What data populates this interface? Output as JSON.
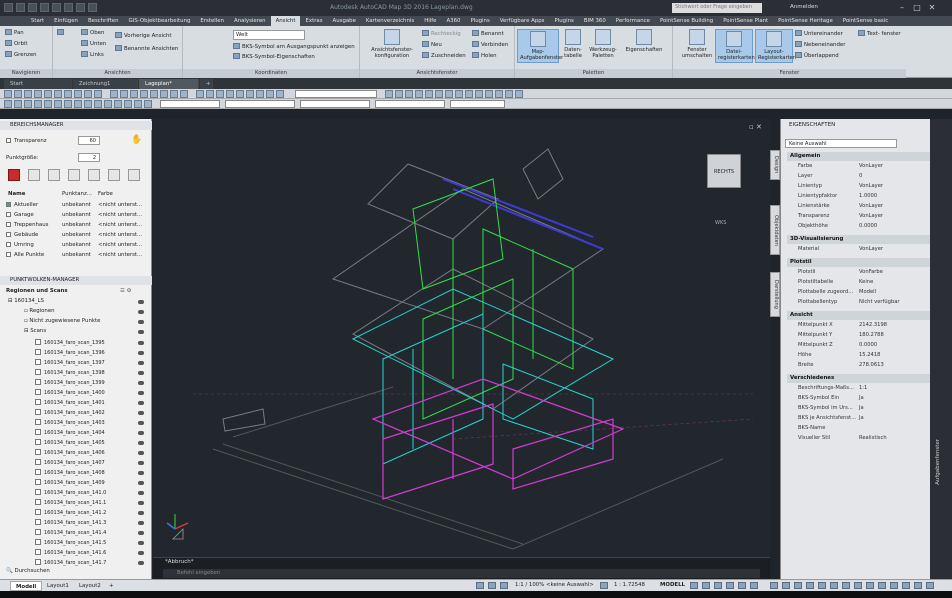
{
  "titlebar": {
    "title": "Autodesk AutoCAD Map 3D 2016   Lageplan.dwg",
    "search_placeholder": "Stichwort oder Frage eingeben",
    "login": "Anmelden"
  },
  "ribbon_tabs": [
    "Start",
    "Einfügen",
    "Beschriften",
    "GIS-Objektbearbeitung",
    "Erstellen",
    "Analysieren",
    "Ansicht",
    "Extras",
    "Ausgabe",
    "Kartenverzeichnis",
    "Hilfe",
    "A360",
    "Plugins",
    "Verfügbare Apps",
    "Plugins",
    "BIM 360",
    "Performance",
    "PointSense Building",
    "PointSense Plant",
    "PointSense Heritage",
    "PointSense basic"
  ],
  "ribbon": {
    "navigate": {
      "title": "Navigieren",
      "items": [
        "Pan",
        "Orbit",
        "Grenzen"
      ]
    },
    "views": {
      "title": "Ansichten",
      "items": [
        "Oben",
        "Unten",
        "Links"
      ],
      "prev_view": "Vorherige Ansicht",
      "named_views": "Benannte Ansichten"
    },
    "coords": {
      "title": "Koordinaten",
      "world": "Welt",
      "ucs_origin": "BKS-Symbol am Ausgangspunkt anzeigen",
      "ucs_props": "BKS-Symbol-Eigenschaften"
    },
    "viewports": {
      "title": "Ansichtsfenster",
      "config": "Ansichtsfenster-konfiguration",
      "rect": "Rechteckig",
      "new": "Neu",
      "clip": "Zuschneiden",
      "named": "Benannt",
      "join": "Verbinden",
      "restore": "Holen"
    },
    "palettes": {
      "title": "Paletten",
      "map_task": "Map-Aufgabenfenster",
      "data_table": "Daten-tabelle",
      "tool_palettes": "Werkzeug-Paletten",
      "properties": "Eigenschaften"
    },
    "window": {
      "title": "Fenster",
      "switch": "Fenster umschalten",
      "file_tabs": "Datei-registerkarten",
      "layout_tabs": "Layout-Registerkarten",
      "tile_h": "Untereinander",
      "tile_v": "Nebeneinander",
      "cascade": "Überlappend",
      "text_window": "Text- fenster"
    }
  },
  "doc_tabs": [
    "Start",
    "Zeichnung1",
    "Lageplan*"
  ],
  "left_panel": {
    "title": "BEREICHSMANAGER",
    "transparency_label": "Transparenz",
    "transparency_value": "60",
    "pointsize_label": "Punktgröße:",
    "pointsize_value": "2",
    "columns": [
      "Name",
      "Punktanz...",
      "Farbe"
    ],
    "regions": [
      {
        "name": "Aktueller",
        "count": "unbekannt",
        "color": "<nicht unterst..."
      },
      {
        "name": "Garage",
        "count": "unbekannt",
        "color": "<nicht unterst..."
      },
      {
        "name": "Treppenhaus",
        "count": "unbekannt",
        "color": "<nicht unterst..."
      },
      {
        "name": "Gebäude",
        "count": "unbekannt",
        "color": "<nicht unterst..."
      },
      {
        "name": "Umring",
        "count": "unbekannt",
        "color": "<nicht unterst..."
      },
      {
        "name": "Alle Punkte",
        "count": "unbekannt",
        "color": "<nicht unterst..."
      }
    ],
    "pcm_title": "PUNKTWOLKEN-MANAGER",
    "pcm_sub": "Regionen und Scans",
    "tree_root": "160134_LS",
    "tree_regions": "Regionen",
    "tree_unassigned": "Nicht zugewiesene Punkte",
    "tree_scans": "Scans",
    "scans": [
      "160134_faro_scan_1395",
      "160134_faro_scan_1396",
      "160134_faro_scan_1397",
      "160134_faro_scan_1398",
      "160134_faro_scan_1399",
      "160134_faro_scan_1400",
      "160134_faro_scan_1401",
      "160134_faro_scan_1402",
      "160134_faro_scan_1403",
      "160134_faro_scan_1404",
      "160134_faro_scan_1405",
      "160134_faro_scan_1406",
      "160134_faro_scan_1407",
      "160134_faro_scan_1408",
      "160134_faro_scan_1409",
      "160134_faro_scan_141.0",
      "160134_faro_scan_141.1",
      "160134_faro_scan_141.2",
      "160134_faro_scan_141.3",
      "160134_faro_scan_141.4",
      "160134_faro_scan_141.5",
      "160134_faro_scan_141.6",
      "160134_faro_scan_141.7"
    ],
    "search": "Durchsuchen"
  },
  "viewport": {
    "viewcube_label": "RECHTS",
    "viewcube_sub": "WKS"
  },
  "command": {
    "history": "*Abbruch*",
    "placeholder": "Befehl eingeben"
  },
  "properties": {
    "title": "EIGENSCHAFTEN",
    "selection": "Keine Auswahl",
    "sections": [
      {
        "title": "Allgemein",
        "rows": [
          [
            "Farbe",
            "VonLayer"
          ],
          [
            "Layer",
            "0"
          ],
          [
            "Linientyp",
            "VonLayer"
          ],
          [
            "Linientypfaktor",
            "1.0000"
          ],
          [
            "Linienstärke",
            "VonLayer"
          ],
          [
            "Transparenz",
            "VonLayer"
          ],
          [
            "Objekthöhe",
            "0.0000"
          ]
        ]
      },
      {
        "title": "3D-Visualisierung",
        "rows": [
          [
            "Material",
            "VonLayer"
          ]
        ]
      },
      {
        "title": "Plotstil",
        "rows": [
          [
            "Plotstil",
            "VonFarbe"
          ],
          [
            "Plotstiltabelle",
            "Keine"
          ],
          [
            "Plottabelle zugeord...",
            "Modell"
          ],
          [
            "Plottabellentyp",
            "Nicht verfügbar"
          ]
        ]
      },
      {
        "title": "Ansicht",
        "rows": [
          [
            "Mittelpunkt X",
            "2142.3198"
          ],
          [
            "Mittelpunkt Y",
            "180.2788"
          ],
          [
            "Mittelpunkt Z",
            "0.0000"
          ],
          [
            "Höhe",
            "15.2418"
          ],
          [
            "Breite",
            "278.0613"
          ]
        ]
      },
      {
        "title": "Verschiedenes",
        "rows": [
          [
            "Beschriftungs-Maßs...",
            "1:1"
          ],
          [
            "BKS-Symbol Ein",
            "Ja"
          ],
          [
            "BKS-Symbol im Urs...",
            "Ja"
          ],
          [
            "BKS je Ansichtsfenst...",
            "Ja"
          ],
          [
            "BKS-Name",
            ""
          ],
          [
            "Visueller Stil",
            "Realistisch"
          ]
        ]
      }
    ],
    "side_tabs": [
      "Design",
      "Objektdaten",
      "Darstellung"
    ],
    "outer_tab": "Aufgabenfenster"
  },
  "status": {
    "layouts": [
      "Modell",
      "Layout1",
      "Layout2"
    ],
    "scale": "1:1 / 100%",
    "selection": "<keine Auswahl>",
    "zoom": "1 : 1.72548",
    "space": "MODELL"
  }
}
